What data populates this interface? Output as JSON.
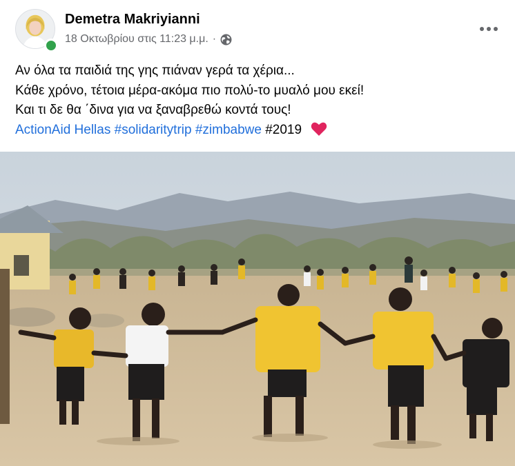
{
  "post": {
    "author": "Demetra Makriyianni",
    "timestamp": "18 Οκτωβρίου στις 11:23 μ.μ.",
    "separator": "·",
    "privacy_icon": "globe-icon",
    "more_icon": "more-dots-icon",
    "text_lines": [
      "Αν όλα τα παιδιά της γης πιάναν γερά τα χέρια...",
      "Κάθε χρόνο, τέτοια μέρα-ακόμα πιο πολύ-το μυαλό μου εκεί!",
      "Και τι δε θα ΄δινα για να ξαναβρεθώ κοντά τους!"
    ],
    "tags": {
      "page": "ActionAid Hellas",
      "hashtag1": "#solidaritytrip",
      "hashtag2": "#zimbabwe",
      "year": "#2019"
    },
    "emoji": "heart-icon"
  },
  "colors": {
    "link": "#216fdb",
    "meta": "#65676b",
    "online": "#31a24c",
    "heart": "#e0245e"
  }
}
